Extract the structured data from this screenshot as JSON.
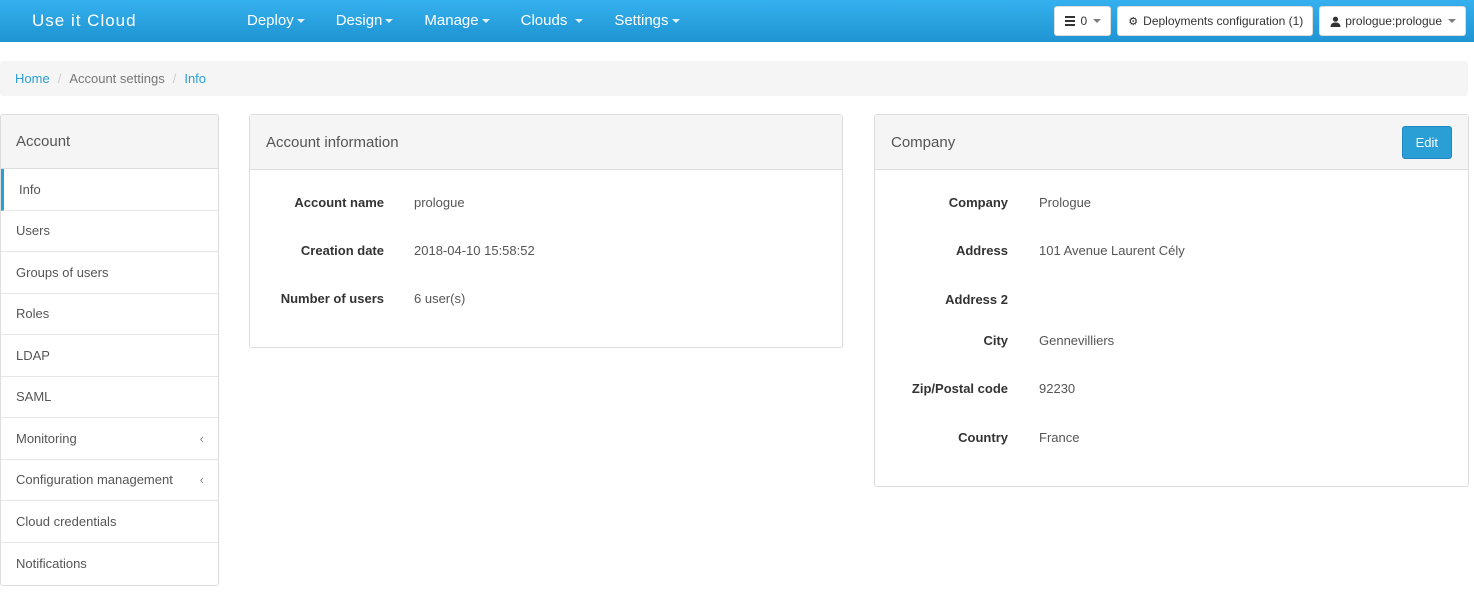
{
  "navbar": {
    "brand": "Use it Cloud",
    "menu": [
      {
        "label": "Deploy"
      },
      {
        "label": "Design"
      },
      {
        "label": "Manage"
      },
      {
        "label": "Clouds"
      },
      {
        "label": "Settings"
      }
    ],
    "tasks_count": "0",
    "deployments_config_label": "Deployments configuration (1)",
    "user_label": "prologue:prologue",
    "accent_color": "#2a9fd6"
  },
  "breadcrumb": {
    "home": "Home",
    "account_settings": "Account settings",
    "current": "Info"
  },
  "sidebar": {
    "title": "Account",
    "items": [
      {
        "label": "Info"
      },
      {
        "label": "Users"
      },
      {
        "label": "Groups of users"
      },
      {
        "label": "Roles"
      },
      {
        "label": "LDAP"
      },
      {
        "label": "SAML"
      },
      {
        "label": "Monitoring",
        "chevron": "‹"
      },
      {
        "label": "Configuration management",
        "chevron": "‹"
      },
      {
        "label": "Cloud credentials"
      },
      {
        "label": "Notifications"
      }
    ]
  },
  "account_info": {
    "title": "Account information",
    "rows": [
      {
        "label": "Account name",
        "value": "prologue"
      },
      {
        "label": "Creation date",
        "value": "2018-04-10 15:58:52"
      },
      {
        "label": "Number of users",
        "value": "6 user(s)"
      }
    ]
  },
  "company": {
    "title": "Company",
    "edit_label": "Edit",
    "rows": [
      {
        "label": "Company",
        "value": "Prologue"
      },
      {
        "label": "Address",
        "value": "101 Avenue Laurent Cély"
      },
      {
        "label": "Address 2",
        "value": ""
      },
      {
        "label": "City",
        "value": "Gennevilliers"
      },
      {
        "label": "Zip/Postal code",
        "value": "92230"
      },
      {
        "label": "Country",
        "value": "France"
      }
    ]
  }
}
